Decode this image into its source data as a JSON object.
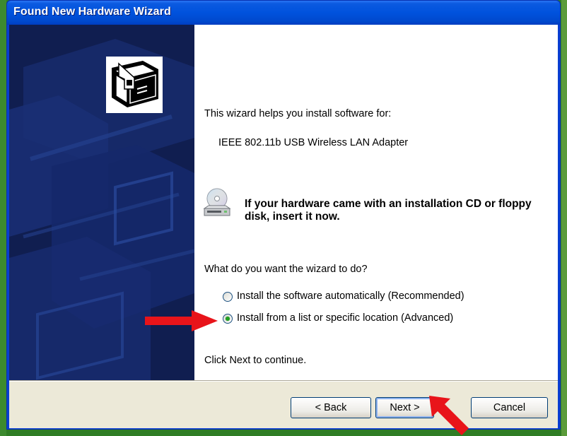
{
  "window": {
    "title": "Found New Hardware Wizard"
  },
  "content": {
    "intro": "This wizard helps you install software for:",
    "device_name": "IEEE 802.11b USB Wireless LAN Adapter",
    "cd_prompt": "If your hardware came with an installation CD or floppy disk, insert it now.",
    "question": "What do you want the wizard to do?",
    "options": [
      {
        "label": "Install the software automatically (Recommended)",
        "selected": false
      },
      {
        "label": "Install from a list or specific location (Advanced)",
        "selected": true
      }
    ],
    "continue_hint": "Click Next to continue."
  },
  "buttons": {
    "back": "< Back",
    "next": "Next >",
    "cancel": "Cancel"
  },
  "icons": {
    "hardware": "hardware-card-icon",
    "cd": "cd-drive-icon",
    "pointer_arrow": "red-arrow-icon"
  },
  "colors": {
    "sidebar": "#101e50",
    "titlebar": "#0052dd",
    "annotation_arrow": "#e8141a"
  }
}
